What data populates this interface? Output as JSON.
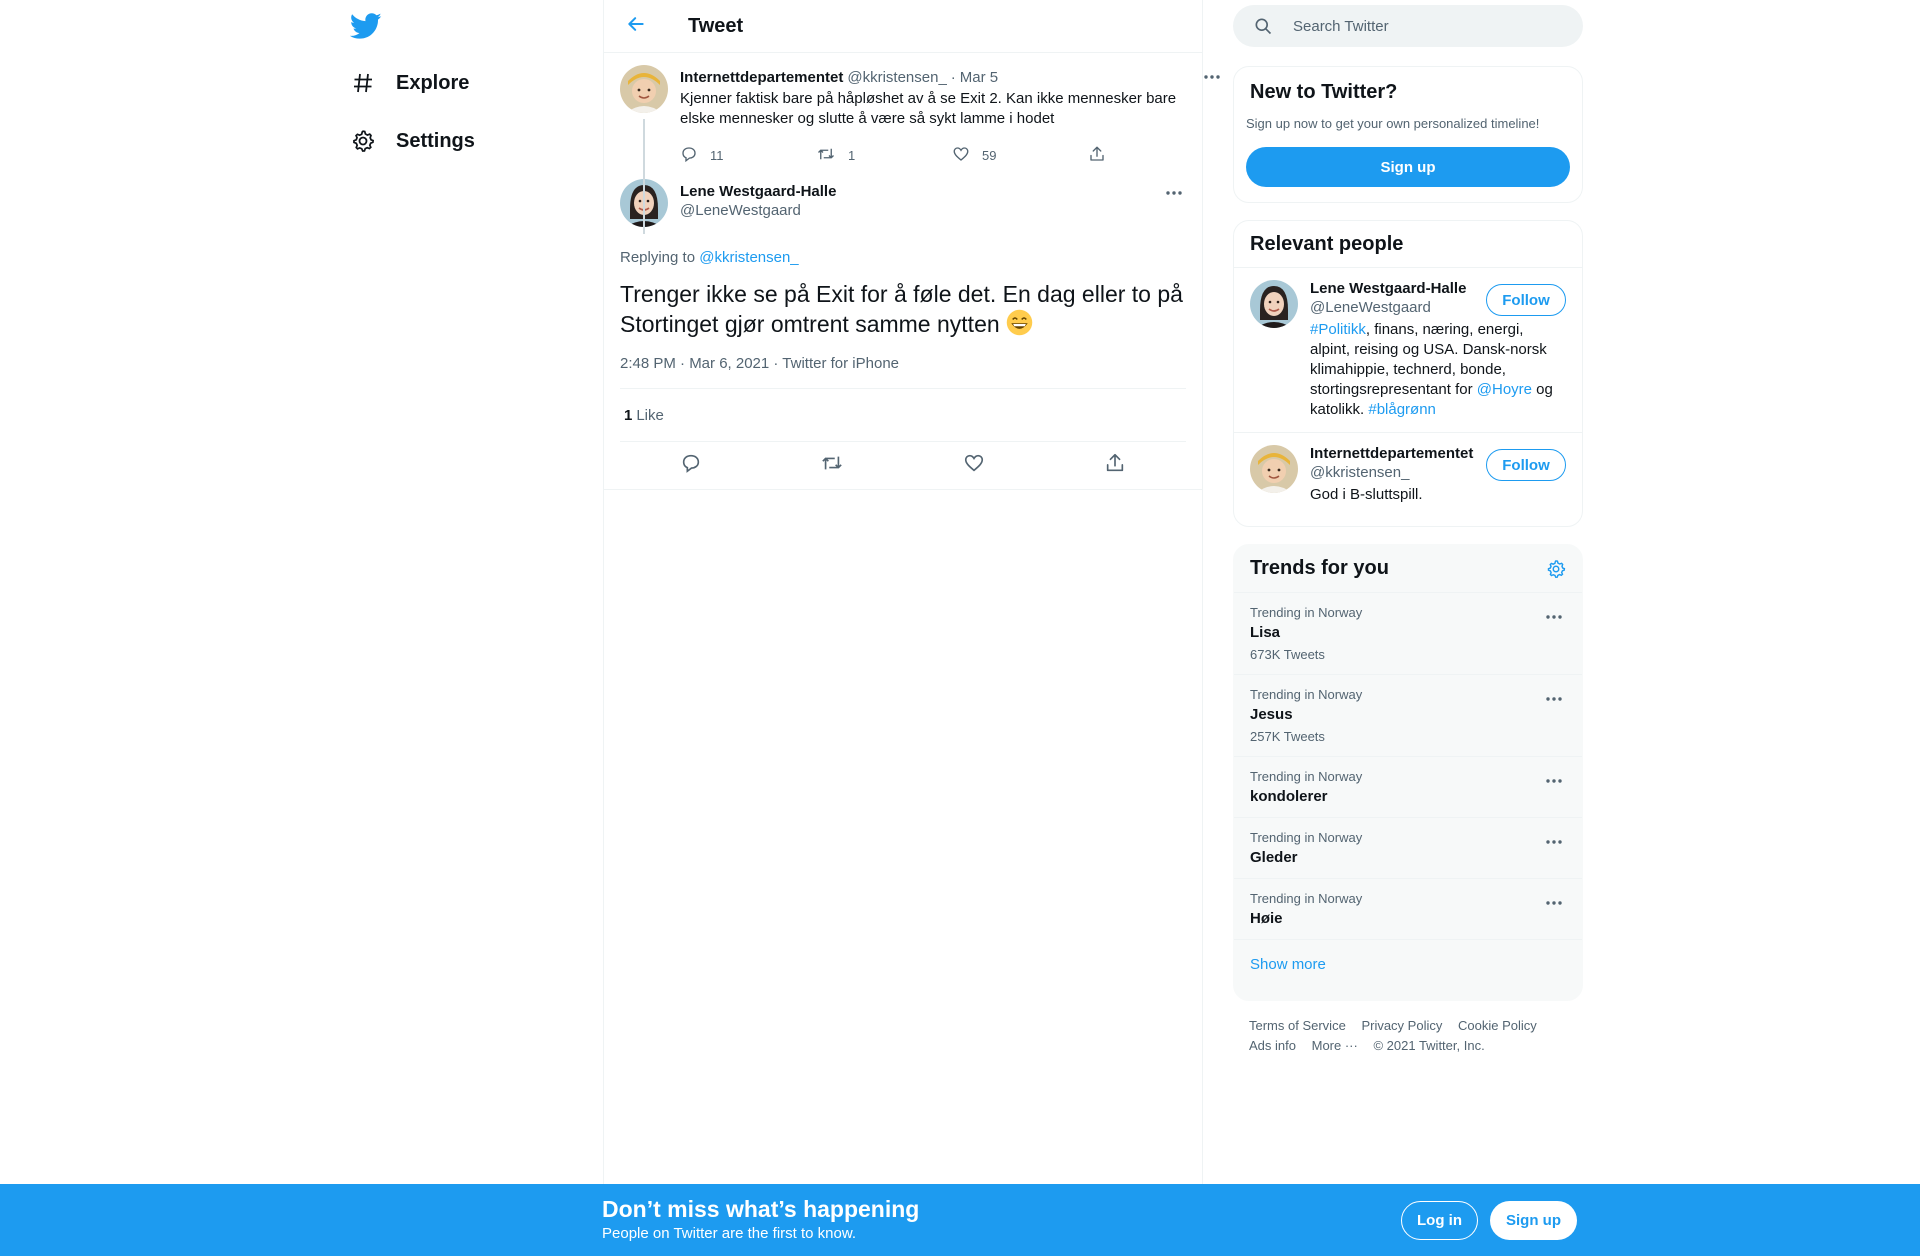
{
  "nav": {
    "logo_icon": "twitter-bird-icon",
    "items": [
      {
        "label": "Explore",
        "icon": "hashtag-icon"
      },
      {
        "label": "Settings",
        "icon": "gear-icon"
      }
    ]
  },
  "header": {
    "back_icon": "arrow-left-icon",
    "title": "Tweet"
  },
  "parent_tweet": {
    "name": "Internettdepartementet",
    "handle": "@kkristensen_",
    "separator": "·",
    "date": "Mar 5",
    "text": "Kjenner faktisk bare på håpløshet av å se Exit 2. Kan ikke mennesker bare elske mennesker og slutte å være så sykt lamme i hodet",
    "replies": "11",
    "retweets": "1",
    "likes": "59"
  },
  "main_tweet": {
    "name": "Lene Westgaard-Halle",
    "handle": "@LeneWestgaard",
    "replying_prefix": "Replying to",
    "replying_to": "@kkristensen_",
    "text": "Trenger ikke se på Exit for å føle det. En dag eller to på Stortinget gjør omtrent samme nytten",
    "emoji": "grinning-face-emoji",
    "meta": "2:48 PM · Mar 6, 2021 · Twitter for iPhone",
    "like_count": "1",
    "like_label": "Like"
  },
  "search": {
    "placeholder": "Search Twitter"
  },
  "new_to_twitter": {
    "title": "New to Twitter?",
    "subtitle": "Sign up now to get your own personalized timeline!",
    "signup_label": "Sign up"
  },
  "relevant_people": {
    "title": "Relevant people",
    "people": [
      {
        "name": "Lene Westgaard-Halle",
        "handle": "@LeneWestgaard",
        "follow_label": "Follow",
        "bio_link1": "#Politikk",
        "bio_text1": ", finans, næring, energi, alpint, reising og USA. Dansk-norsk klimahippie, technerd, bonde, stortingsrepresentant for ",
        "bio_link2": "@Hoyre",
        "bio_text2": " og katolikk. ",
        "bio_link3": "#blågrønn"
      },
      {
        "name": "Internettdepartementet",
        "handle": "@kkristensen_",
        "follow_label": "Follow",
        "bio": "God i B-sluttspill."
      }
    ]
  },
  "trends": {
    "title": "Trends for you",
    "items": [
      {
        "context": "Trending in Norway",
        "name": "Lisa",
        "count": "673K Tweets"
      },
      {
        "context": "Trending in Norway",
        "name": "Jesus",
        "count": "257K Tweets"
      },
      {
        "context": "Trending in Norway",
        "name": "kondolerer",
        "count": ""
      },
      {
        "context": "Trending in Norway",
        "name": "Gleder",
        "count": ""
      },
      {
        "context": "Trending in Norway",
        "name": "Høie",
        "count": ""
      }
    ],
    "show_more": "Show more"
  },
  "footer": {
    "terms": "Terms of Service",
    "privacy": "Privacy Policy",
    "cookie": "Cookie Policy",
    "ads": "Ads info",
    "more": "More ···",
    "copyright": "© 2021 Twitter, Inc."
  },
  "bottom_bar": {
    "title": "Don’t miss what’s happening",
    "subtitle": "People on Twitter are the first to know.",
    "login_label": "Log in",
    "signup_label": "Sign up"
  },
  "colors": {
    "accent": "#1d9bf0",
    "text_primary": "#0f1419",
    "text_secondary": "#536471",
    "border": "#eff3f4"
  }
}
